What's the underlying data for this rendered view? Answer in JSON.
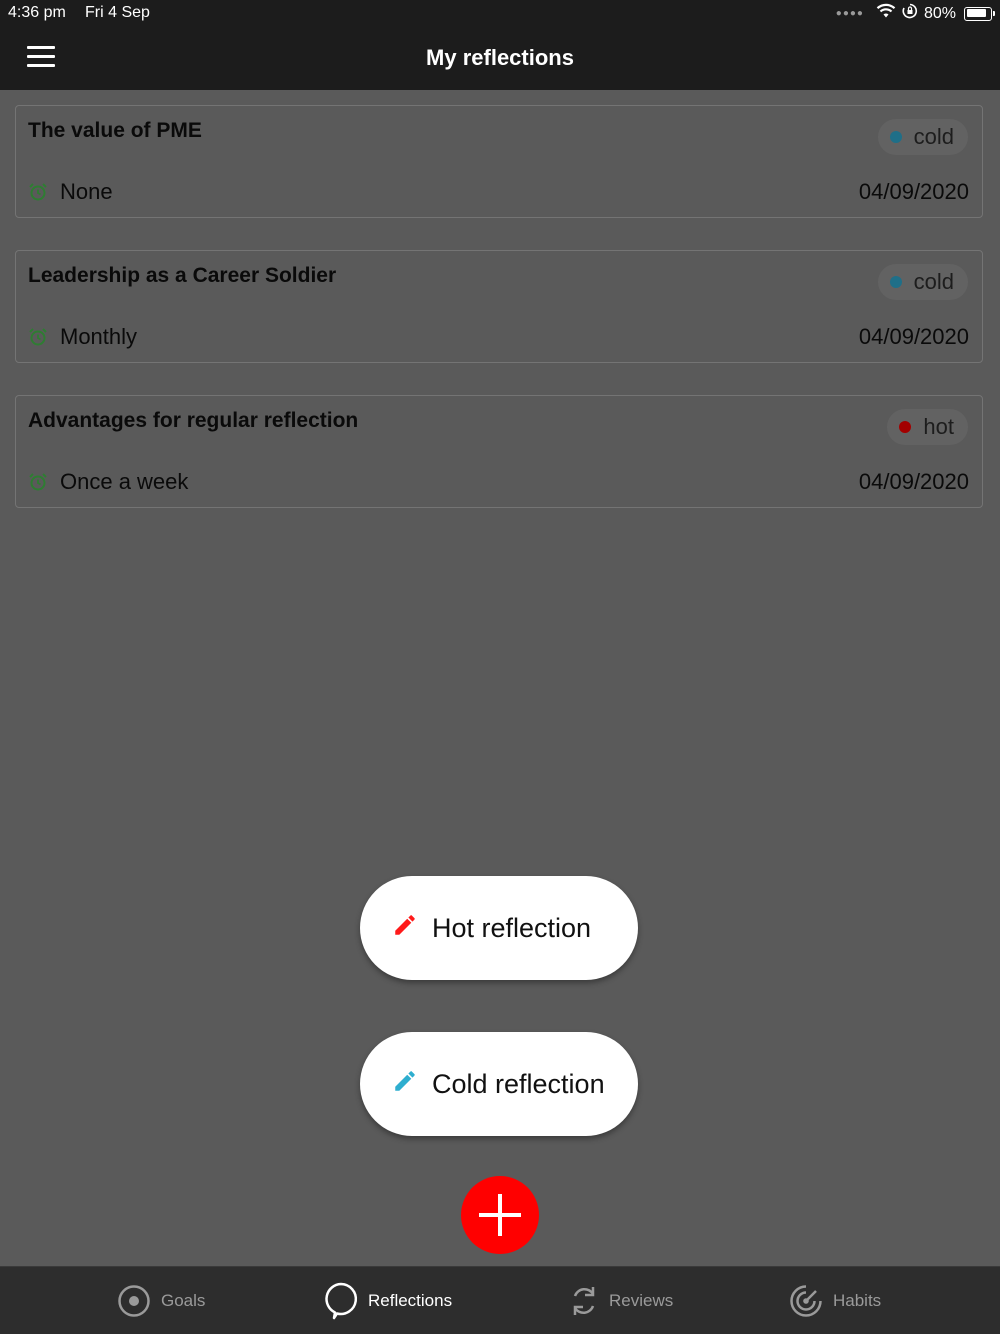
{
  "status_bar": {
    "time": "4:36 pm",
    "date": "Fri 4 Sep",
    "battery": "80%"
  },
  "header": {
    "title": "My reflections"
  },
  "reflections": [
    {
      "title": "The value of PME",
      "type": "cold",
      "frequency": "None",
      "date": "04/09/2020"
    },
    {
      "title": "Leadership as a Career Soldier",
      "type": "cold",
      "frequency": "Monthly",
      "date": "04/09/2020"
    },
    {
      "title": "Advantages for regular reflection",
      "type": "hot",
      "frequency": "Once a week",
      "date": "04/09/2020"
    }
  ],
  "fab_menu": {
    "hot_label": "Hot reflection",
    "cold_label": "Cold reflection"
  },
  "tabs": [
    {
      "label": "Goals",
      "icon": "target-icon",
      "active": false
    },
    {
      "label": "Reflections",
      "icon": "speech-bubble-icon",
      "active": true
    },
    {
      "label": "Reviews",
      "icon": "refresh-icon",
      "active": false
    },
    {
      "label": "Habits",
      "icon": "radar-icon",
      "active": false
    }
  ],
  "colors": {
    "cold_dot": "#1f6f88",
    "hot_dot": "#a30000",
    "alarm_icon": "#2e7d32",
    "fab": "#ff0000",
    "hot_pencil": "#ff1a1a",
    "cold_pencil": "#2eaecf"
  }
}
